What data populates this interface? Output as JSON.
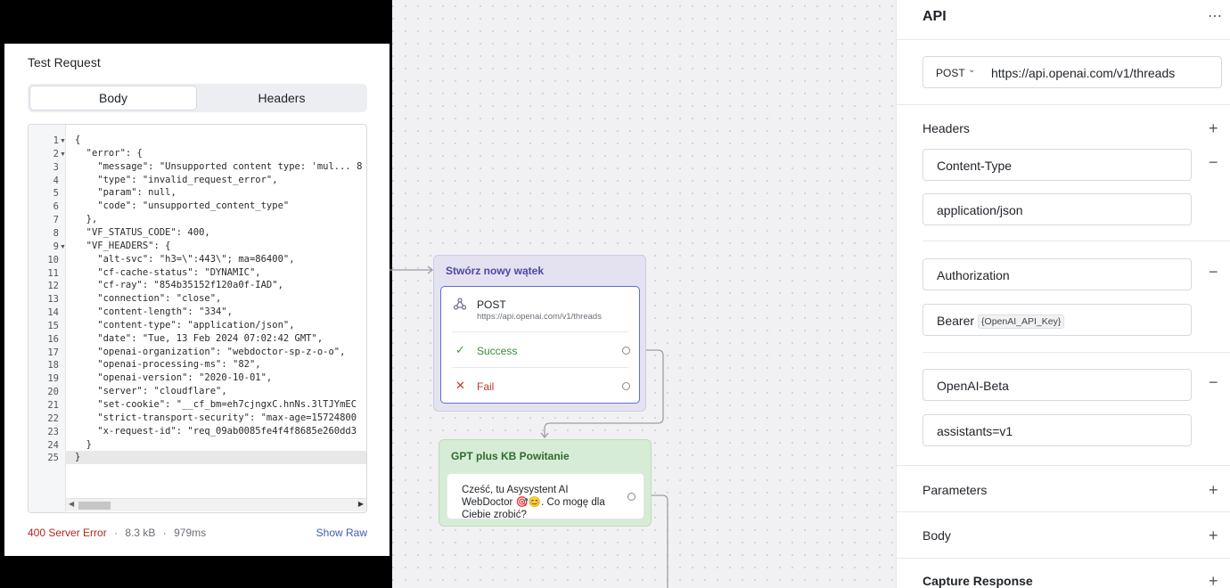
{
  "test_request": {
    "title": "Test Request",
    "tabs": {
      "body": "Body",
      "headers": "Headers"
    },
    "response_lines": [
      "{",
      "  \"error\": {",
      "    \"message\": \"Unsupported content type: 'mul... 8",
      "    \"type\": \"invalid_request_error\",",
      "    \"param\": null,",
      "    \"code\": \"unsupported_content_type\"",
      "  },",
      "  \"VF_STATUS_CODE\": 400,",
      "  \"VF_HEADERS\": {",
      "    \"alt-svc\": \"h3=\\\":443\\\"; ma=86400\",",
      "    \"cf-cache-status\": \"DYNAMIC\",",
      "    \"cf-ray\": \"854b35152f120a0f-IAD\",",
      "    \"connection\": \"close\",",
      "    \"content-length\": \"334\",",
      "    \"content-type\": \"application/json\",",
      "    \"date\": \"Tue, 13 Feb 2024 07:02:42 GMT\",",
      "    \"openai-organization\": \"webdoctor-sp-z-o-o\",",
      "    \"openai-processing-ms\": \"82\",",
      "    \"openai-version\": \"2020-10-01\",",
      "    \"server\": \"cloudflare\",",
      "    \"set-cookie\": \"__cf_bm=eh7cjngxC.hnNs.3lTJYmEC",
      "    \"strict-transport-security\": \"max-age=15724800",
      "    \"x-request-id\": \"req_09ab0085fe4f4f8685e260dd3",
      "  }",
      "}"
    ],
    "status": {
      "error": "400 Server Error",
      "size": "8.3 kB",
      "time": "979ms",
      "separator": "·",
      "show_raw": "Show Raw"
    }
  },
  "canvas": {
    "api_node": {
      "title": "Stwórz nowy wątek",
      "method": "POST",
      "url": "https://api.openai.com/v1/threads",
      "success_label": "Success",
      "fail_label": "Fail"
    },
    "gpt_node": {
      "title": "GPT plus KB Powitanie",
      "message": "Cześć, tu Asysystent AI WebDoctor 🎯😊. Co mogę dla Ciebie zrobić?"
    }
  },
  "right_panel": {
    "title": "API",
    "more_icon": "⋯",
    "method": "POST",
    "url": "https://api.openai.com/v1/threads",
    "headers_label": "Headers",
    "headers": [
      {
        "key": "Content-Type",
        "value": "application/json"
      },
      {
        "key": "Authorization",
        "value_prefix": "Bearer",
        "value_var": "{OpenAI_API_Key}"
      },
      {
        "key": "OpenAI-Beta",
        "value": "assistants=v1"
      }
    ],
    "parameters_label": "Parameters",
    "body_label": "Body",
    "capture_label": "Capture Response"
  }
}
